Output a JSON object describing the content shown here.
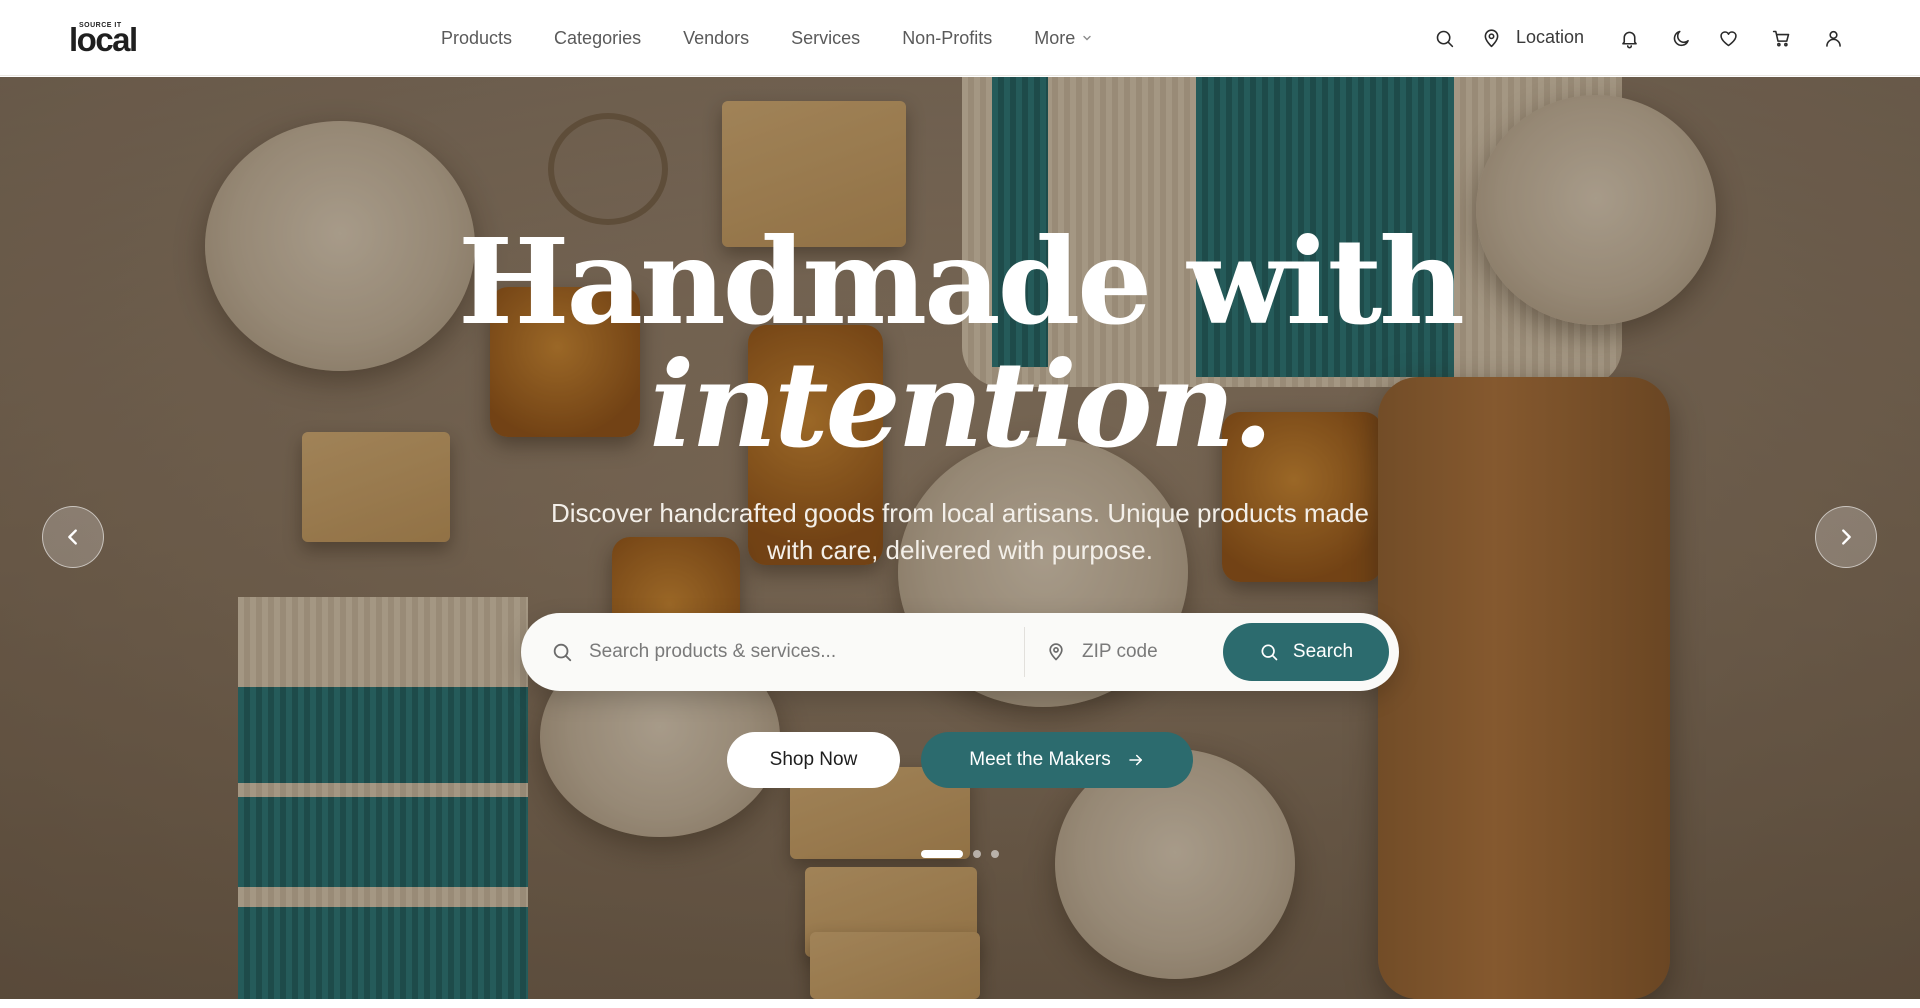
{
  "brand": {
    "logo_small": "SOURCE IT",
    "logo_main": "local"
  },
  "nav": {
    "items": [
      {
        "label": "Products"
      },
      {
        "label": "Categories"
      },
      {
        "label": "Vendors"
      },
      {
        "label": "Services"
      },
      {
        "label": "Non-Profits"
      }
    ],
    "more_label": "More"
  },
  "toolbar": {
    "icons": [
      "search-icon",
      "location-pin-icon",
      "bell-icon",
      "moon-icon",
      "heart-icon",
      "cart-icon",
      "user-icon"
    ],
    "location_label": "Location"
  },
  "hero": {
    "title_line1": "Handmade with",
    "title_line2": "intention.",
    "subtitle_line1": "Discover handcrafted goods from local artisans. Unique products made",
    "subtitle_line2": "with care, delivered with purpose.",
    "search": {
      "placeholder": "Search products & services...",
      "zip_placeholder": "ZIP code",
      "button_label": "Search"
    },
    "cta_primary": "Shop Now",
    "cta_secondary": "Meet the Makers",
    "carousel": {
      "slide_count": 3,
      "active_slide": 1
    }
  },
  "colors": {
    "accent": "#2c6b6e",
    "header_bg": "#ffffff",
    "nav_text": "#5a5a5a"
  }
}
